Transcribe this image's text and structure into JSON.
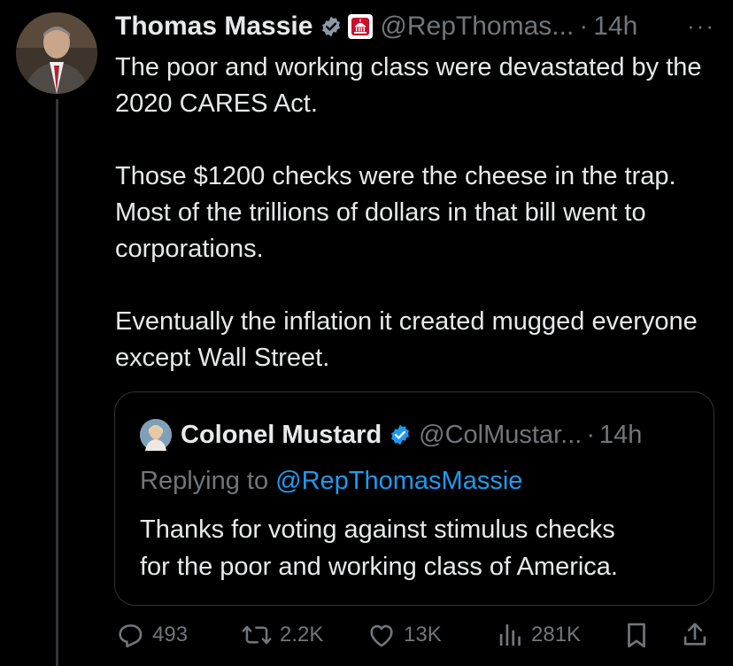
{
  "post": {
    "display_name": "Thomas Massie",
    "handle": "@RepThomas...",
    "separator": "·",
    "time": "14h",
    "more_label": "···",
    "text": "The poor and working class were devastated by the 2020 CARES Act.\n\nThose $1200 checks were the cheese in the trap.  Most of the trillions of dollars in that bill went to corporations.\n\nEventually the inflation it created mugged everyone except Wall Street.",
    "icons": {
      "verified": "verified-badge-icon",
      "affiliation": "capitol-building-icon",
      "more": "more-options-icon"
    }
  },
  "quote": {
    "display_name": "Colonel Mustard",
    "handle": "@ColMustar...",
    "separator": "·",
    "time": "14h",
    "replying_prefix": "Replying to ",
    "replying_to": "@RepThomasMassie",
    "text": "Thanks for voting against stimulus checks\nfor the poor and working class of America."
  },
  "actions": {
    "replies": "493",
    "reposts": "2.2K",
    "likes": "13K",
    "views": "281K",
    "icons": [
      "reply-icon",
      "repost-icon",
      "like-icon",
      "views-icon",
      "bookmark-icon",
      "share-icon"
    ]
  },
  "colors": {
    "background": "#000000",
    "text": "#e7e9ea",
    "muted": "#71767b",
    "accent": "#1d9bf0",
    "border": "#2f3336",
    "gov_red": "#c8102e"
  }
}
